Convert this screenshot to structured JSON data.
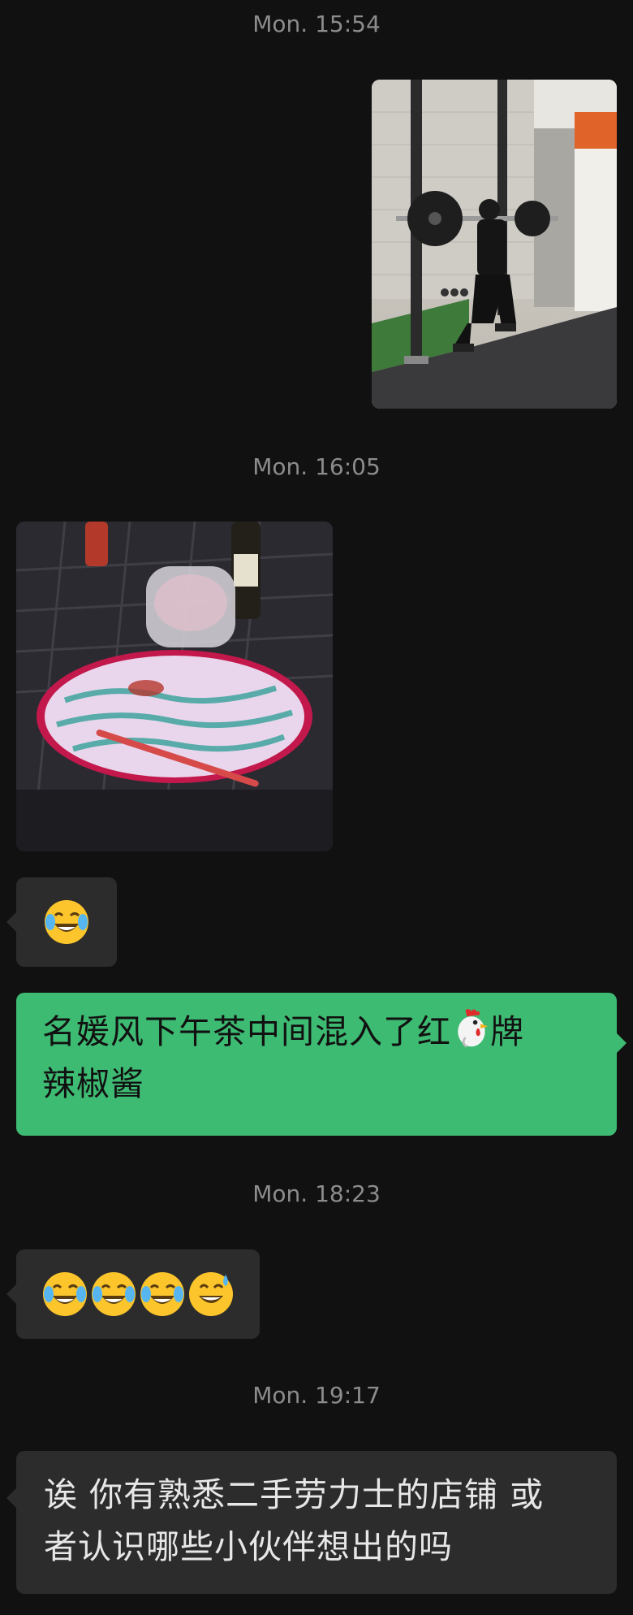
{
  "messages": {
    "ts1": "Mon. 15:54",
    "photo1_icon": "gym-squat-photo",
    "ts2": "Mon. 16:05",
    "photo2_icon": "tea-table-plate-photo",
    "emoji1_icon": "tears-of-joy-emoji",
    "msg_out": "名媛风下午茶中间混入了红",
    "msg_out_icon": "rooster-emoji",
    "msg_out_tail": "牌",
    "msg_out_line2": "辣椒酱",
    "ts3": "Mon. 18:23",
    "emoji_row_icons": [
      "tears-of-joy-emoji",
      "tears-of-joy-emoji",
      "tears-of-joy-emoji",
      "grinning-sweat-emoji"
    ],
    "ts4": "Mon. 19:17",
    "msg_in_line1": "诶 你有熟悉二手劳力士的店铺 或",
    "msg_in_line2": "者认识哪些小伙伴想出的吗"
  },
  "colors": {
    "background": "#111111",
    "incoming_bubble": "#2c2c2c",
    "outgoing_bubble": "#3ebb73",
    "timestamp": "#8c8c8c"
  }
}
